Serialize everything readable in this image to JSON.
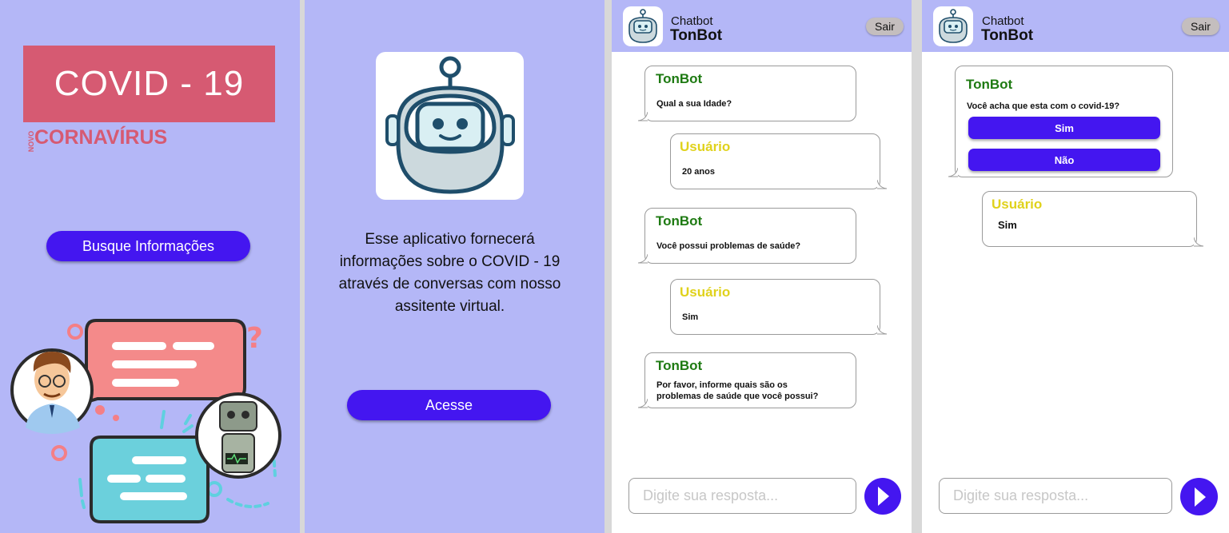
{
  "screen1": {
    "headline": "COVID - 19",
    "novo": "NOVO",
    "subtitle": "CORNAVÍRUS",
    "search_button": "Busque Informações"
  },
  "screen2": {
    "description": "Esse aplicativo fornecerá informações sobre o COVID - 19 através de conversas com nosso assitente virtual.",
    "access_button": "Acesse"
  },
  "chat_header": {
    "subtitle": "Chatbot",
    "title": "TonBot",
    "exit_button": "Sair"
  },
  "chat1": {
    "messages": [
      {
        "sender": "TonBot",
        "text": "Qual a sua Idade?"
      },
      {
        "sender": "Usuário",
        "text": "20 anos"
      },
      {
        "sender": "TonBot",
        "text": "Você possui problemas de saúde?"
      },
      {
        "sender": "Usuário",
        "text": "Sim"
      },
      {
        "sender": "TonBot",
        "text_line1": "Por favor, informe quais são os",
        "text_line2": "problemas de saúde que você possui?"
      }
    ],
    "input_placeholder": "Digite sua resposta..."
  },
  "chat2": {
    "messages": [
      {
        "sender": "TonBot",
        "text": "Você acha que esta com o covid-19?",
        "options": [
          "Sim",
          "Não"
        ]
      },
      {
        "sender": "Usuário",
        "text": "Sim"
      }
    ],
    "input_placeholder": "Digite sua resposta..."
  },
  "colors": {
    "background": "#b4b7f7",
    "primary_button": "#4416f0",
    "covid_red": "#d65a72",
    "bot_name": "#1e7a12",
    "user_name": "#e0d21c"
  }
}
